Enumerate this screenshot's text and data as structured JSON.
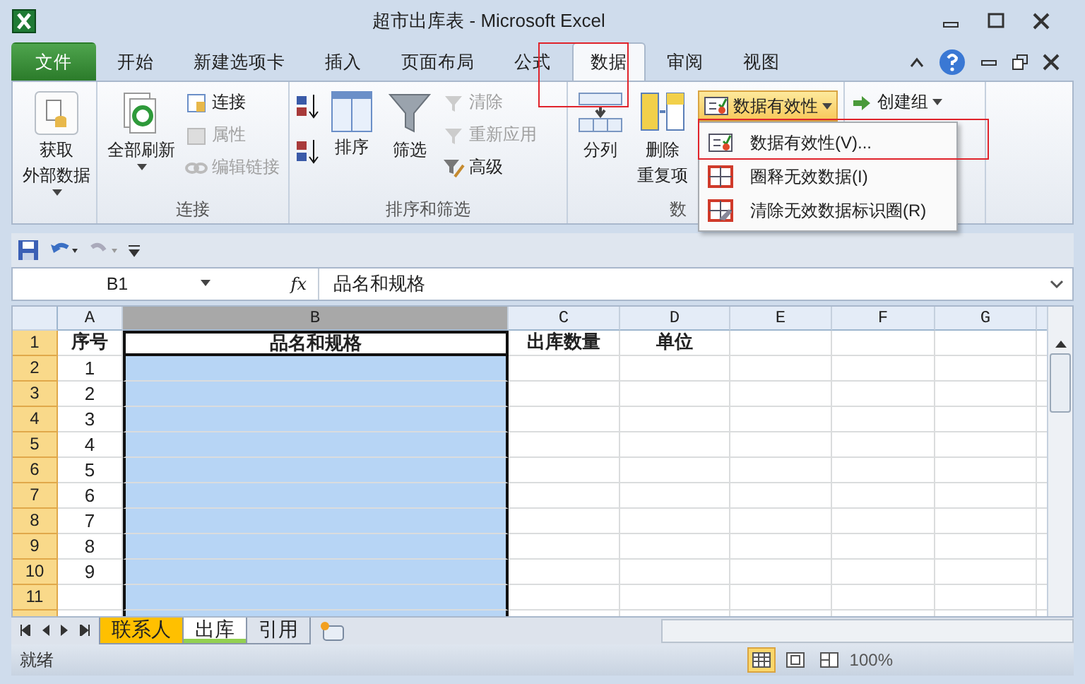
{
  "window": {
    "title": "超市出库表 - Microsoft Excel"
  },
  "tabs": [
    {
      "label": "文件",
      "kind": "file",
      "selected": false
    },
    {
      "label": "开始",
      "kind": "tab",
      "selected": false
    },
    {
      "label": "新建选项卡",
      "kind": "tab",
      "selected": false
    },
    {
      "label": "插入",
      "kind": "tab",
      "selected": false
    },
    {
      "label": "页面布局",
      "kind": "tab",
      "selected": false
    },
    {
      "label": "公式",
      "kind": "tab",
      "selected": false
    },
    {
      "label": "数据",
      "kind": "tab",
      "selected": true
    },
    {
      "label": "审阅",
      "kind": "tab",
      "selected": false
    },
    {
      "label": "视图",
      "kind": "tab",
      "selected": false
    }
  ],
  "ribbon": {
    "groups": [
      {
        "items": [
          {
            "kind": "large",
            "lines": [
              "获取",
              "外部数据"
            ],
            "dropdown": true
          }
        ]
      },
      {
        "label": "连接",
        "items": [
          {
            "kind": "large",
            "lines": [
              "全部刷新"
            ],
            "dropdown": true
          },
          {
            "kind": "small",
            "label": "连接",
            "disabled": false
          },
          {
            "kind": "small",
            "label": "属性",
            "disabled": true
          },
          {
            "kind": "small",
            "label": "编辑链接",
            "disabled": true
          }
        ]
      },
      {
        "label": "排序和筛选",
        "items": [
          {
            "kind": "sortpair"
          },
          {
            "kind": "large",
            "lines": [
              "排序"
            ]
          },
          {
            "kind": "large",
            "lines": [
              "筛选"
            ]
          },
          {
            "kind": "small",
            "label": "清除",
            "disabled": true
          },
          {
            "kind": "small",
            "label": "重新应用",
            "disabled": true
          },
          {
            "kind": "small",
            "label": "高级",
            "disabled": false
          }
        ]
      },
      {
        "label": "数",
        "items": [
          {
            "kind": "large",
            "lines": [
              "分列"
            ]
          },
          {
            "kind": "large",
            "lines": [
              "删除",
              "重复项"
            ]
          },
          {
            "kind": "split",
            "label": "数据有效性"
          }
        ]
      },
      {
        "items": [
          {
            "kind": "small",
            "label": "创建组",
            "dropdown": true,
            "disabled": false
          }
        ]
      }
    ]
  },
  "menu": {
    "items": [
      {
        "label": "数据有效性(V)...",
        "highlighted": true
      },
      {
        "label": "圈释无效数据(I)",
        "highlighted": false
      },
      {
        "label": "清除无效数据标识圈(R)",
        "highlighted": false
      }
    ]
  },
  "formula_bar": {
    "name_box": "B1",
    "fx": "fx",
    "formula": "品名和规格"
  },
  "columns": [
    {
      "letter": "A",
      "selected": false
    },
    {
      "letter": "B",
      "selected": true
    },
    {
      "letter": "C",
      "selected": false
    },
    {
      "letter": "D",
      "selected": false
    },
    {
      "letter": "E",
      "selected": false
    },
    {
      "letter": "F",
      "selected": false
    },
    {
      "letter": "G",
      "selected": false
    }
  ],
  "rows": [
    {
      "number": "1",
      "selected": true,
      "active": true,
      "cells": {
        "A": "序号",
        "B": "品名和规格",
        "C": "出库数量",
        "D": "单位"
      }
    },
    {
      "number": "2",
      "selected": true,
      "active": false,
      "cells": {
        "A": "1"
      }
    },
    {
      "number": "3",
      "selected": true,
      "active": false,
      "cells": {
        "A": "2"
      }
    },
    {
      "number": "4",
      "selected": true,
      "active": false,
      "cells": {
        "A": "3"
      }
    },
    {
      "number": "5",
      "selected": true,
      "active": false,
      "cells": {
        "A": "4"
      }
    },
    {
      "number": "6",
      "selected": true,
      "active": false,
      "cells": {
        "A": "5"
      }
    },
    {
      "number": "7",
      "selected": true,
      "active": false,
      "cells": {
        "A": "6"
      }
    },
    {
      "number": "8",
      "selected": true,
      "active": false,
      "cells": {
        "A": "7"
      }
    },
    {
      "number": "9",
      "selected": true,
      "active": false,
      "cells": {
        "A": "8"
      }
    },
    {
      "number": "10",
      "selected": true,
      "active": false,
      "cells": {
        "A": "9"
      }
    },
    {
      "number": "11",
      "selected": true,
      "active": false,
      "cells": {}
    }
  ],
  "sheets": [
    {
      "label": "联系人",
      "selected": false,
      "color": "#ffc000"
    },
    {
      "label": "出库",
      "selected": true,
      "color": "#92d050"
    },
    {
      "label": "引用",
      "selected": false
    }
  ],
  "status_bar": {
    "status": "就绪",
    "views": [
      {
        "selected": true
      },
      {
        "selected": false
      },
      {
        "selected": false
      }
    ],
    "zoom": "100%"
  }
}
